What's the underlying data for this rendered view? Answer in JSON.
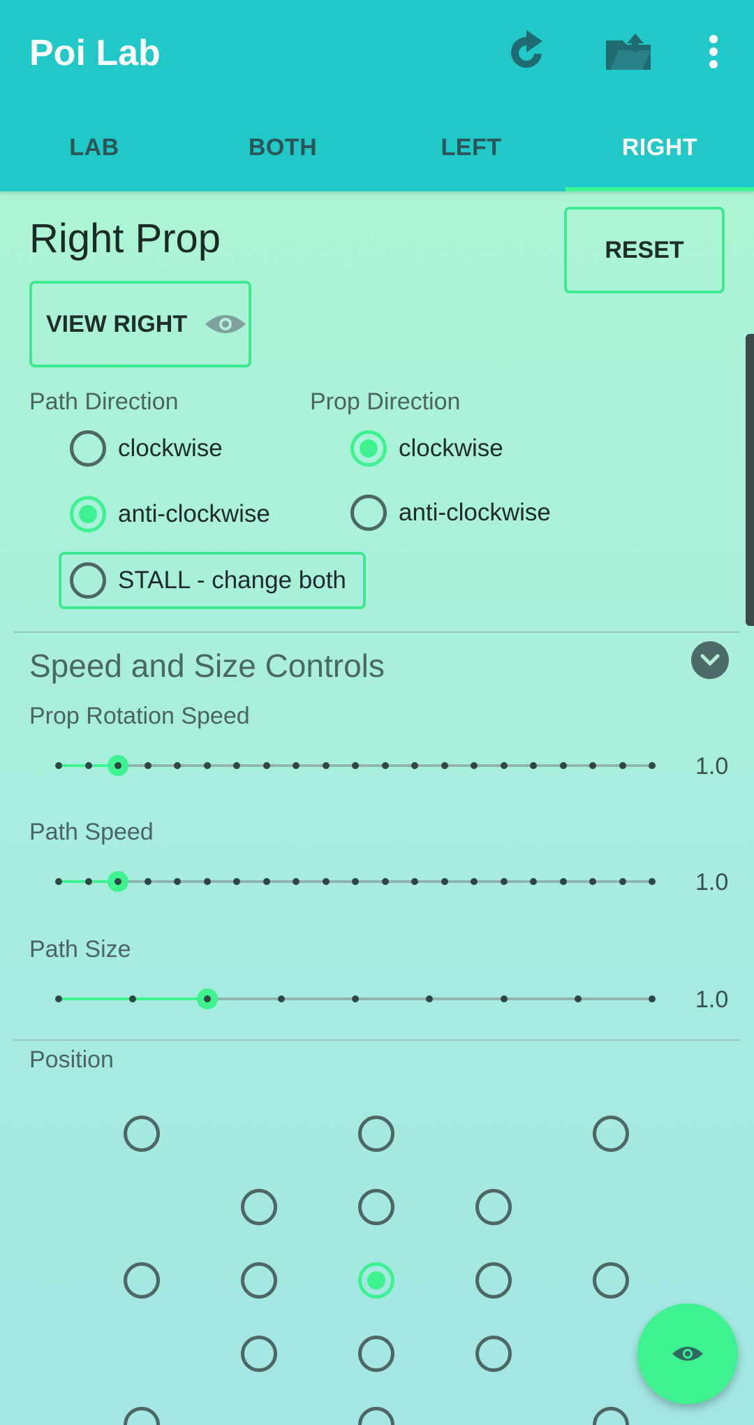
{
  "app": {
    "title": "Poi Lab",
    "icons": [
      "redo-icon",
      "folder-upload-icon",
      "more-vert-icon"
    ]
  },
  "tabs": [
    {
      "label": "LAB",
      "active": false
    },
    {
      "label": "BOTH",
      "active": false
    },
    {
      "label": "LEFT",
      "active": false
    },
    {
      "label": "RIGHT",
      "active": true
    }
  ],
  "page": {
    "title": "Right Prop",
    "reset_label": "RESET",
    "view_label": "VIEW RIGHT"
  },
  "path_direction": {
    "label": "Path Direction",
    "options": [
      {
        "label": "clockwise",
        "checked": false
      },
      {
        "label": "anti-clockwise",
        "checked": true
      },
      {
        "label": "STALL - change both",
        "checked": false
      }
    ]
  },
  "prop_direction": {
    "label": "Prop Direction",
    "options": [
      {
        "label": "clockwise",
        "checked": true
      },
      {
        "label": "anti-clockwise",
        "checked": false
      }
    ]
  },
  "speed_size": {
    "header": "Speed and Size Controls",
    "sliders": [
      {
        "label": "Prop Rotation Speed",
        "value": "1.0",
        "steps": 21,
        "position": 2
      },
      {
        "label": "Path Speed",
        "value": "1.0",
        "steps": 21,
        "position": 2
      },
      {
        "label": "Path Size",
        "value": "1.0",
        "steps": 9,
        "position": 2
      }
    ]
  },
  "position": {
    "label": "Position",
    "selected": "center"
  },
  "colors": {
    "appbar": "#20c8c8",
    "accent": "#3ef290",
    "text": "#1e2b2a"
  }
}
